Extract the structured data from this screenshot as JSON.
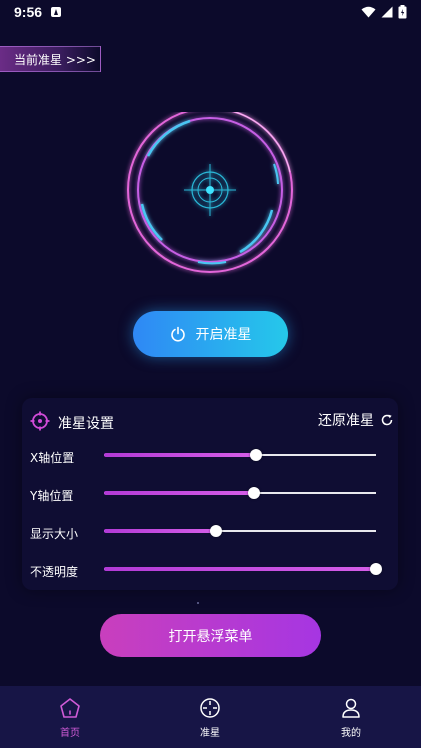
{
  "status_bar": {
    "time": "9:56"
  },
  "current_crosshair_tag": "当前准星 >>>",
  "start_button_label": "开启准星",
  "settings": {
    "title": "准星设置",
    "restore_label": "还原准星",
    "sliders": [
      {
        "label": "X轴位置",
        "value": 0.56
      },
      {
        "label": "Y轴位置",
        "value": 0.55
      },
      {
        "label": "显示大小",
        "value": 0.41
      },
      {
        "label": "不透明度",
        "value": 1.0
      }
    ]
  },
  "float_menu_button_label": "打开悬浮菜单",
  "bottom_nav": {
    "items": [
      {
        "label": "首页",
        "icon": "home-icon",
        "active": true
      },
      {
        "label": "准星",
        "icon": "crosshair-icon",
        "active": false
      },
      {
        "label": "我的",
        "icon": "profile-icon",
        "active": false
      }
    ]
  },
  "colors": {
    "background": "#0c0a2b",
    "accent_pink": "#d24bd8",
    "accent_blue": "#2f88f5",
    "accent_cyan": "#25c8ea",
    "nav_active": "#cf5bd6",
    "nav_inactive": "#ffffff"
  }
}
